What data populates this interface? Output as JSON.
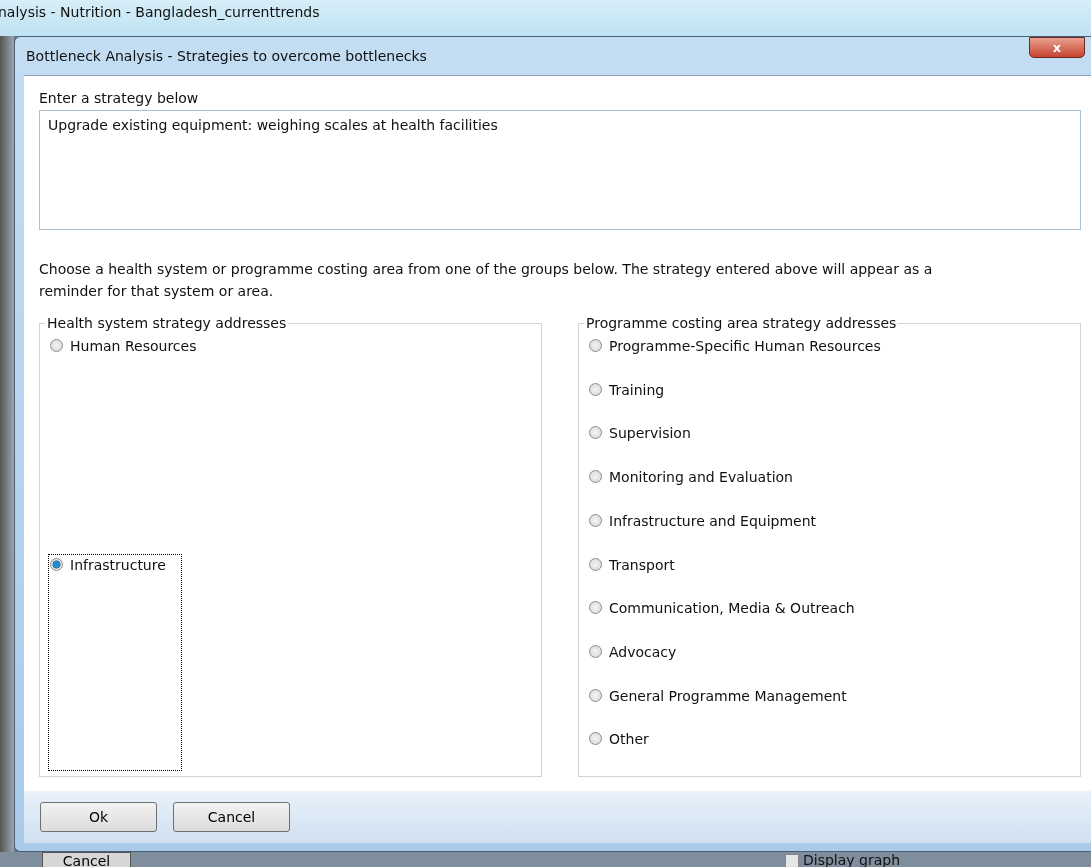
{
  "background_window": {
    "title": "nalysis - Nutrition - Bangladesh_currenttrends",
    "cancel_button": "Cancel",
    "display_graph": {
      "label": "Display graph",
      "checked": false
    }
  },
  "dialog": {
    "title": "Bottleneck Analysis - Strategies to overcome bottlenecks",
    "close": "x",
    "strategy_label": "Enter a strategy below",
    "strategy_value": "Upgrade existing equipment: weighing scales at health facilities",
    "instructions": "Choose a health system or programme costing area from one of the groups below.  The strategy entered above will appear as a reminder for that system or area.",
    "health_group": {
      "title": "Health system strategy addresses",
      "options": [
        {
          "label": "Human Resources",
          "selected": false,
          "focused": false
        },
        {
          "label": "Infrastructure",
          "selected": true,
          "focused": true
        }
      ]
    },
    "programme_group": {
      "title": "Programme costing area strategy addresses",
      "options": [
        {
          "label": "Programme-Specific Human Resources",
          "selected": false
        },
        {
          "label": "Training",
          "selected": false
        },
        {
          "label": "Supervision",
          "selected": false
        },
        {
          "label": "Monitoring and Evaluation",
          "selected": false
        },
        {
          "label": "Infrastructure and Equipment",
          "selected": false
        },
        {
          "label": "Transport",
          "selected": false
        },
        {
          "label": "Communication, Media & Outreach",
          "selected": false
        },
        {
          "label": "Advocacy",
          "selected": false
        },
        {
          "label": "General Programme Management",
          "selected": false
        },
        {
          "label": "Other",
          "selected": false
        }
      ]
    },
    "buttons": [
      "Ok",
      "Cancel"
    ]
  }
}
